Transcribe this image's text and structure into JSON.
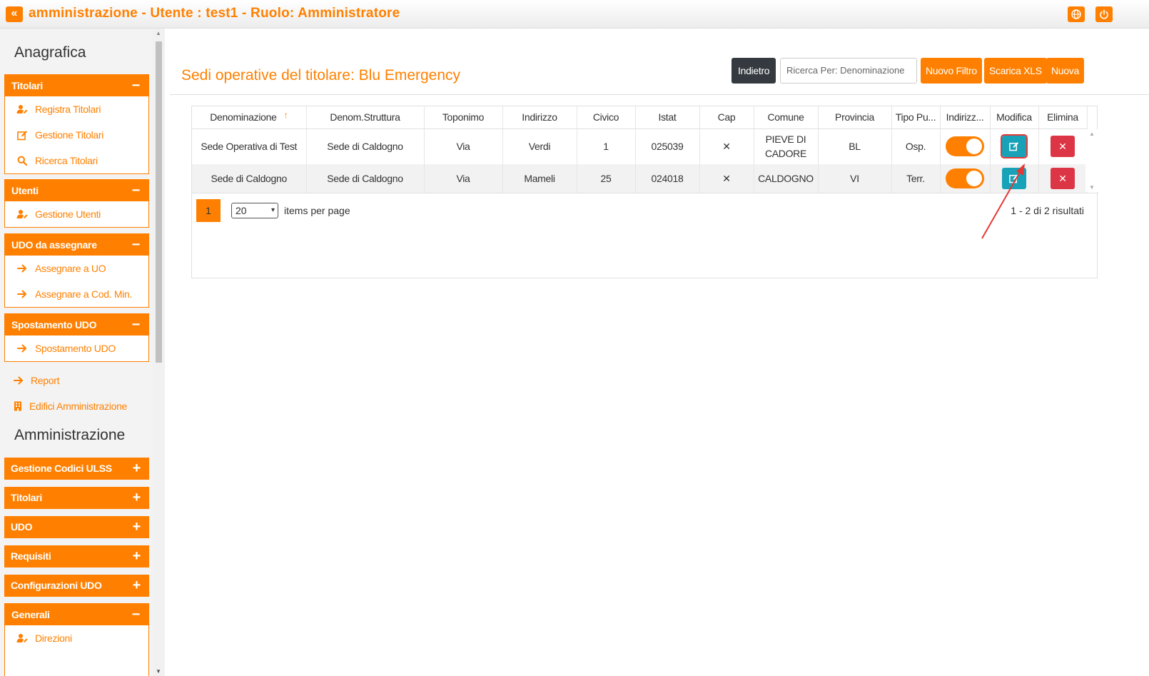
{
  "header": {
    "collapse_glyph": "«",
    "title": "amministrazione - Utente : test1 - Ruolo: Amministratore"
  },
  "sidebar": {
    "section_anagrafica": "Anagrafica",
    "titolari": {
      "title": "Titolari",
      "toggle": "−",
      "items": [
        {
          "label": "Registra Titolari",
          "icon": "user-edit-icon"
        },
        {
          "label": "Gestione Titolari",
          "icon": "edit-icon"
        },
        {
          "label": "Ricerca Titolari",
          "icon": "search-icon"
        }
      ]
    },
    "utenti": {
      "title": "Utenti",
      "toggle": "−",
      "items": [
        {
          "label": "Gestione Utenti",
          "icon": "user-edit-icon"
        }
      ]
    },
    "udo_assegnare": {
      "title": "UDO da assegnare",
      "toggle": "−",
      "items": [
        {
          "label": "Assegnare a UO",
          "icon": "arrow-right-icon"
        },
        {
          "label": "Assegnare a Cod. Min.",
          "icon": "arrow-right-icon"
        }
      ]
    },
    "spostamento": {
      "title": "Spostamento UDO",
      "toggle": "−",
      "items": [
        {
          "label": "Spostamento UDO",
          "icon": "arrow-right-icon"
        }
      ]
    },
    "report": "Report",
    "edifici": "Edifici Amministrazione",
    "section_amministrazione": "Amministrazione",
    "closed_panels": [
      {
        "title": "Gestione Codici ULSS",
        "toggle": "+"
      },
      {
        "title": "Titolari",
        "toggle": "+"
      },
      {
        "title": "UDO",
        "toggle": "+"
      },
      {
        "title": "Requisiti",
        "toggle": "+"
      },
      {
        "title": "Configurazioni UDO",
        "toggle": "+"
      }
    ],
    "generali": {
      "title": "Generali",
      "toggle": "−",
      "items": [
        {
          "label": "Direzioni",
          "icon": "user-edit-icon"
        }
      ]
    }
  },
  "main": {
    "page_title": "Sedi operative del titolare: Blu Emergency",
    "buttons": {
      "back": "Indietro",
      "new_filter": "Nuovo Filtro",
      "download_xls": "Scarica XLS",
      "new": "Nuova"
    },
    "search": {
      "placeholder": "Ricerca Per: Denominazione",
      "value": ""
    },
    "grid": {
      "sort_arrow": "↑",
      "columns": [
        "Denominazione",
        "Denom.Struttura",
        "Toponimo",
        "Indirizzo",
        "Civico",
        "Istat",
        "Cap",
        "Comune",
        "Provincia",
        "Tipo Pu...",
        "Indirizz...",
        "Modifica",
        "Elimina"
      ],
      "rows": [
        {
          "denominazione": "Sede Operativa di Test",
          "struttura": "Sede di Caldogno",
          "toponimo": "Via",
          "indirizzo": "Verdi",
          "civico": "1",
          "istat": "025039",
          "cap": "✕",
          "comune": "PIEVE DI CADORE",
          "provincia": "BL",
          "tipo": "Osp.",
          "toggle_on": true
        },
        {
          "denominazione": "Sede di Caldogno",
          "struttura": "Sede di Caldogno",
          "toponimo": "Via",
          "indirizzo": "Mameli",
          "civico": "25",
          "istat": "024018",
          "cap": "✕",
          "comune": "CALDOGNO",
          "provincia": "VI",
          "tipo": "Terr.",
          "toggle_on": true
        }
      ],
      "delete_glyph": "✕",
      "pager": {
        "current_page": "1",
        "page_size": "20",
        "page_size_caret": "▾",
        "items_per_page": "items per page",
        "results": "1 - 2 di 2 risultati"
      }
    }
  },
  "colors": {
    "accent": "#ff8000",
    "edit": "#17a2b8",
    "delete": "#dc3545",
    "dark": "#343a40",
    "annotation": "#e53935"
  }
}
